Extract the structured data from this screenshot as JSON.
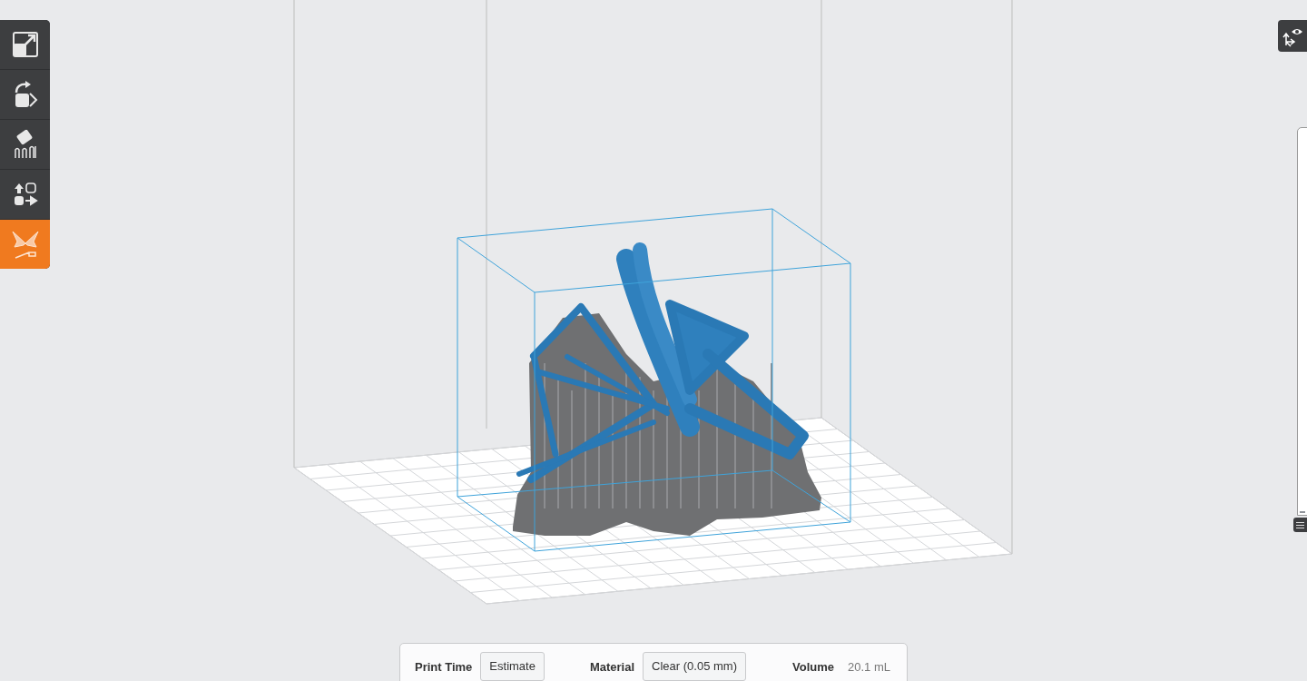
{
  "toolbar": {
    "tools": [
      {
        "kind": "scale",
        "selected": false
      },
      {
        "kind": "rotate",
        "selected": false
      },
      {
        "kind": "supports",
        "selected": false
      },
      {
        "kind": "layout",
        "selected": false
      },
      {
        "kind": "print",
        "selected": true
      }
    ]
  },
  "layer_slider": {
    "level": 0
  },
  "status_bar": {
    "print_time": {
      "label": "Print Time",
      "button": "Estimate"
    },
    "material": {
      "label": "Material",
      "button": "Clear (0.05 mm)"
    },
    "volume": {
      "label": "Volume",
      "value": "20.1 mL"
    }
  }
}
